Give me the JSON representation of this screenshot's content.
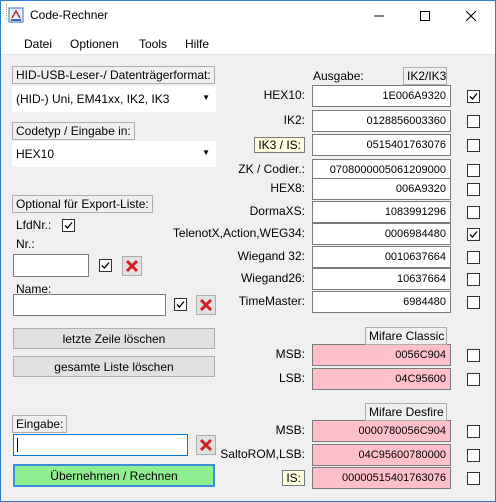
{
  "window": {
    "title": "Code-Rechner",
    "minimize_icon": "minimize-icon",
    "maximize_icon": "maximize-icon",
    "close_icon": "close-icon"
  },
  "menu": {
    "items": [
      "Datei",
      "Optionen",
      "Tools",
      "Hilfe"
    ]
  },
  "left": {
    "reader_label": "HID-USB-Leser-/ Datenträgerformat:",
    "reader_value": "(HID-) Uni, EM41xx, IK2, IK3",
    "codetype_label": "Codetyp / Eingabe in:",
    "codetype_value": "HEX10",
    "export_label": "Optional für Export-Liste:",
    "lfdnr_label": "LfdNr.:",
    "nr_label": "Nr.:",
    "nr_value": "",
    "name_label": "Name:",
    "name_value": "",
    "btn_delete_last": "letzte Zeile löschen",
    "btn_delete_all": "gesamte Liste löschen",
    "eingabe_label": "Eingabe:",
    "eingabe_value": "",
    "btn_apply": "Übernehmen / Rechnen"
  },
  "right": {
    "ausgabe_label": "Ausgabe:",
    "ausgabe_format": "IK2/IK3",
    "rows1": [
      {
        "label": "HEX10:",
        "value": "1E006A9320",
        "checked": true
      },
      {
        "label": "IK2:",
        "value": "0128856003360",
        "checked": false
      },
      {
        "label": "IK3 / IS:",
        "value": "0515401763076",
        "checked": false
      },
      {
        "label": "ZK / Codier.:",
        "value": "0708000005061209000",
        "checked": false
      }
    ],
    "rows2": [
      {
        "label": "HEX8:",
        "value": "006A9320",
        "checked": false
      },
      {
        "label": "DormaXS:",
        "value": "1083991296",
        "checked": false
      },
      {
        "label": "TelenotX,Action,WEG34:",
        "value": "0006984480",
        "checked": true
      },
      {
        "label": "Wiegand 32:",
        "value": "0010637664",
        "checked": false
      },
      {
        "label": "Wiegand26:",
        "value": "10637664",
        "checked": false
      },
      {
        "label": "TimeMaster:",
        "value": "6984480",
        "checked": false
      }
    ],
    "mifare_classic_label": "Mifare Classic",
    "rows3": [
      {
        "label": "MSB:",
        "value": "0056C904",
        "checked": false
      },
      {
        "label": "LSB:",
        "value": "04C95600",
        "checked": false
      }
    ],
    "mifare_desfire_label": "Mifare Desfire",
    "rows4": [
      {
        "label": "MSB:",
        "value": "0000780056C904",
        "checked": false
      },
      {
        "label": "SaltoROM,LSB:",
        "value": "04C95600780000",
        "checked": false
      },
      {
        "label": "IS:",
        "value": "00000515401763076",
        "checked": false
      }
    ]
  },
  "colors": {
    "pink_field": "#ffc0cb",
    "green_button": "#90ee90",
    "delete_red": "#d21f1f"
  }
}
